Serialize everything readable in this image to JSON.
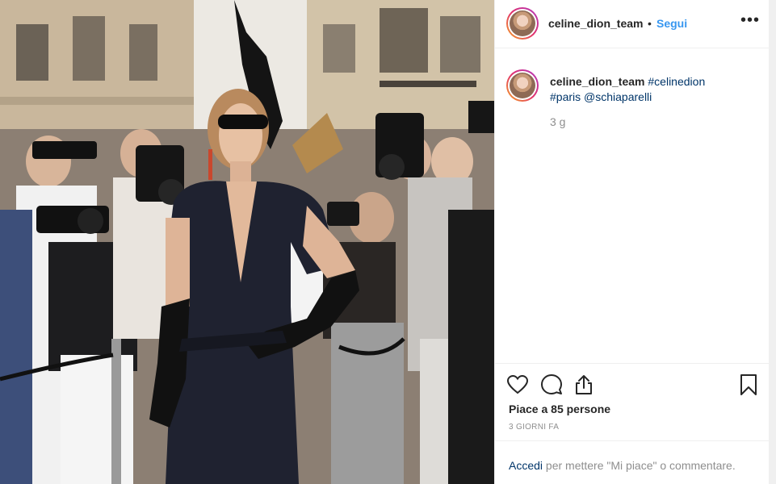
{
  "header": {
    "username": "celine_dion_team",
    "separator": "•",
    "follow_label": "Segui",
    "more_label": "•••"
  },
  "caption": {
    "username": "celine_dion_team",
    "hashtag_1": "#celinedion",
    "hashtag_2": "#paris",
    "mention": "@schiaparelli",
    "age": "3 g"
  },
  "actions": {
    "like_icon": "heart-icon",
    "comment_icon": "comment-icon",
    "share_icon": "share-icon",
    "save_icon": "bookmark-icon"
  },
  "likes_text": "Piace a 85 persone",
  "timestamp": "3 GIORNI FA",
  "login_prompt": {
    "link": "Accedi",
    "rest": " per mettere \"Mi piace\" o commentare."
  },
  "colors": {
    "accent": "#3897f0",
    "hashtag": "#003569",
    "muted": "#8e8e8e"
  }
}
